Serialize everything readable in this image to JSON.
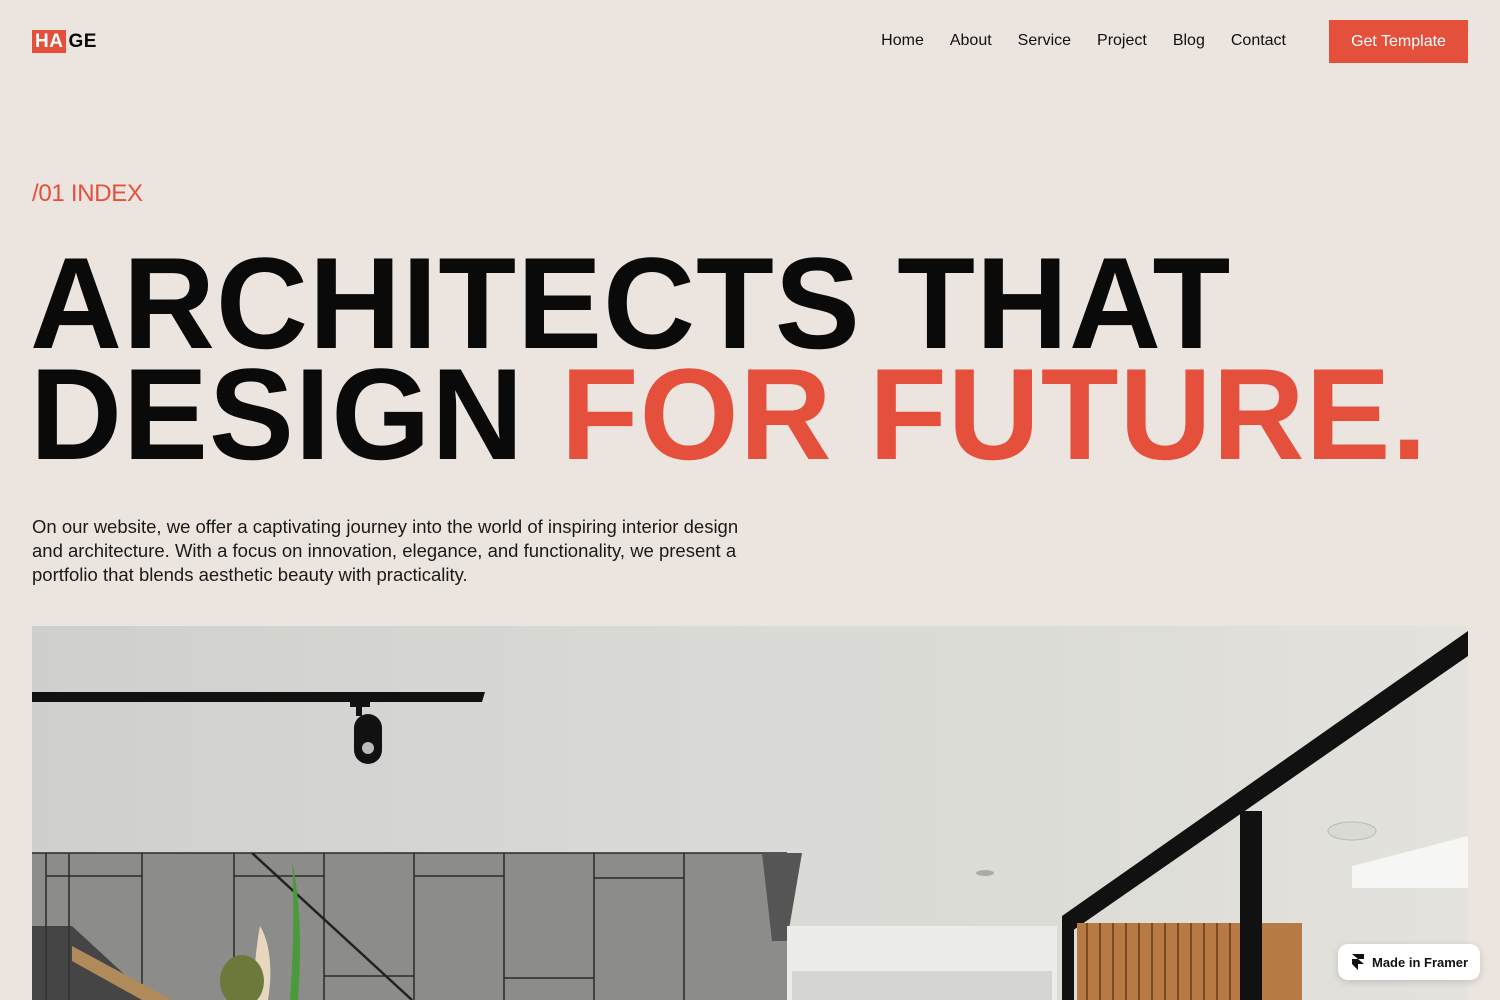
{
  "brand": {
    "logo_highlight": "HA",
    "logo_rest": "GE",
    "accent_color": "#e4503c",
    "background_color": "#ece5df"
  },
  "nav": {
    "items": [
      {
        "label": "Home"
      },
      {
        "label": "About"
      },
      {
        "label": "Service"
      },
      {
        "label": "Project"
      },
      {
        "label": "Blog"
      },
      {
        "label": "Contact"
      }
    ],
    "cta_label": "Get Template"
  },
  "hero": {
    "index_label": "/01 INDEX",
    "headline_line1": "ARCHITECTS THAT",
    "headline_line2_plain": "DESIGN ",
    "headline_line2_accent": "FOR FUTURE.",
    "intro": "On our website, we offer a captivating journey into the world of inspiring interior design and architecture. With a focus on innovation, elegance, and functionality, we present a portfolio that blends aesthetic beauty with practicality."
  },
  "image": {
    "description": "Modern interior with ceiling track light, concrete tile wall, glass staircase, black window frame and timber slats"
  },
  "badge": {
    "label": "Made in Framer",
    "icon": "framer-logo-icon"
  }
}
